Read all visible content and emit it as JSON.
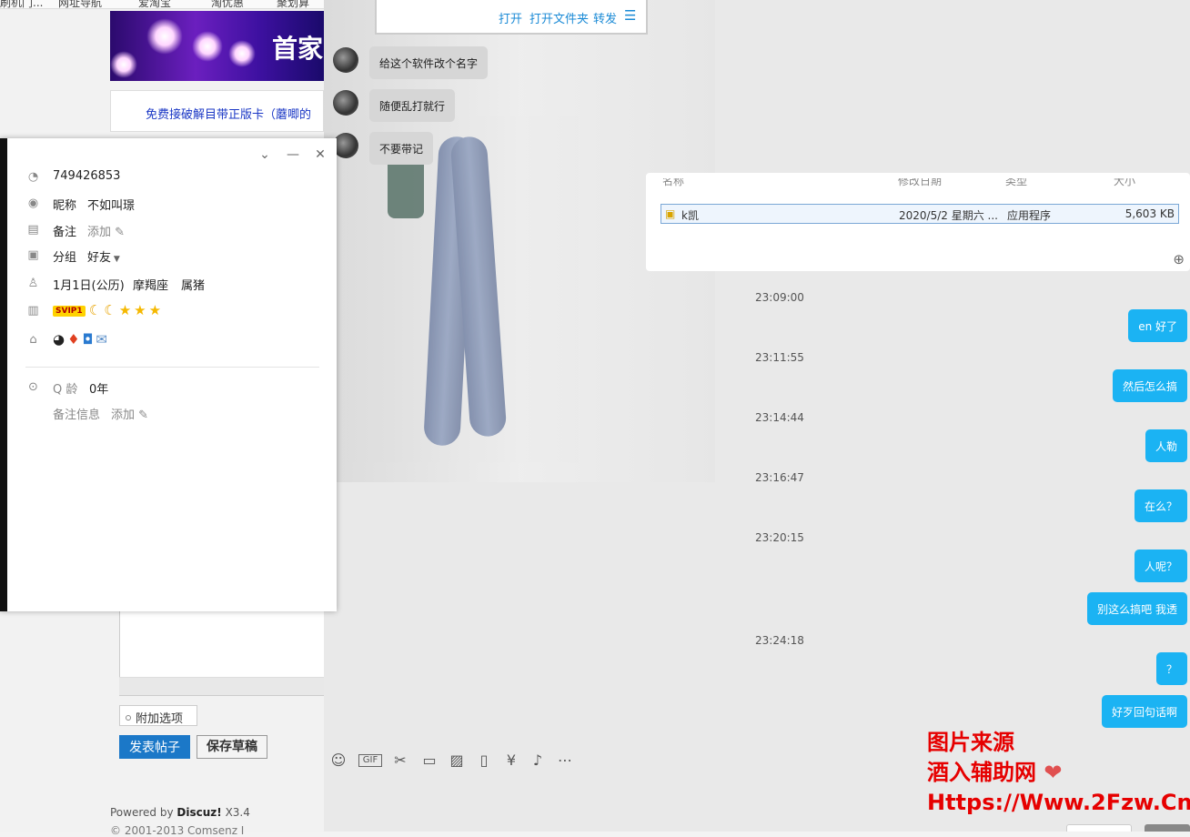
{
  "browser": {
    "bookmarks": [
      "刷机门...",
      "网址导航",
      "爱淘宝",
      "淘优惠",
      "聚划算"
    ]
  },
  "forum": {
    "banner_text": "首家",
    "notice": "免费接破解目带正版卡（蘑唧的",
    "extra_options": "附加选项",
    "post_button": "发表帖子",
    "draft_button": "保存草稿",
    "powered_prefix": "Powered by",
    "powered_brand": "Discuz!",
    "powered_version": "X3.4",
    "copyright": "© 2001-2013 Comsenz I"
  },
  "profile": {
    "qq_number": "749426853",
    "nickname_label": "昵称",
    "nickname": "不如叫璟",
    "remark_label": "备注",
    "remark_add": "添加",
    "group_label": "分组",
    "group_value": "好友",
    "birthday": "1月1日(公历)",
    "constellation": "摩羯座",
    "zodiac": "属猪",
    "vip_badge": "SVIP1",
    "qage_label": "Q 龄",
    "qage_value": "0年",
    "remark_info_label": "备注信息",
    "remark_info_add": "添加"
  },
  "chat": {
    "file_actions": [
      "打开",
      "打开文件夹",
      "转发"
    ],
    "incoming": [
      "给这个软件改个名字",
      "随便乱打就行",
      "不要带记"
    ],
    "file_table": {
      "headers": [
        "名称",
        "修改日期",
        "类型",
        "大小"
      ],
      "row": {
        "name": "k凯",
        "date": "2020/5/2 星期六 ...",
        "type": "应用程序",
        "size": "5,603 KB"
      }
    },
    "messages": [
      {
        "time": "23:09:00"
      },
      {
        "text": "en 好了"
      },
      {
        "time": "23:11:55"
      },
      {
        "text": "然后怎么搞"
      },
      {
        "time": "23:14:44"
      },
      {
        "text": "人勒"
      },
      {
        "time": "23:16:47"
      },
      {
        "text": "在么？"
      },
      {
        "time": "23:20:15"
      },
      {
        "text": "人呢？"
      },
      {
        "text": "别这么搞吧 我透"
      },
      {
        "time": "23:24:18"
      },
      {
        "text": "？"
      },
      {
        "text": "好歹回句话啊"
      }
    ],
    "watermark": [
      "图片来源",
      "酒入辅助网",
      "Https://Www.2Fzw.Cn"
    ]
  },
  "colors": {
    "accent": "#1bb3f3",
    "post_button": "#1b78c8",
    "watermark": "#e60000"
  }
}
